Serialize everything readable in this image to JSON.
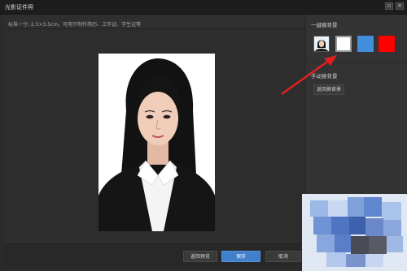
{
  "window": {
    "title": "光影证件照",
    "minimize_glyph": "▫",
    "close_glyph": "×"
  },
  "main": {
    "spec_text": "标准一寸: 2.5×3.5cm，可用于制作简历、工作证、学生证等"
  },
  "buttons": {
    "back_preview": "返回预览",
    "save": "保存",
    "cancel": "取消"
  },
  "right_panel": {
    "one_click_title": "一键换背景",
    "swatches": [
      {
        "name": "white",
        "color": "#ffffff"
      },
      {
        "name": "blue",
        "color": "#438edb"
      },
      {
        "name": "red",
        "color": "#ff0000"
      }
    ],
    "manual_title": "手动换背景",
    "back_bg_button": "返回换背景"
  },
  "colors": {
    "accent_blue": "#3f7fcc",
    "annotation_arrow": "#e02020"
  }
}
